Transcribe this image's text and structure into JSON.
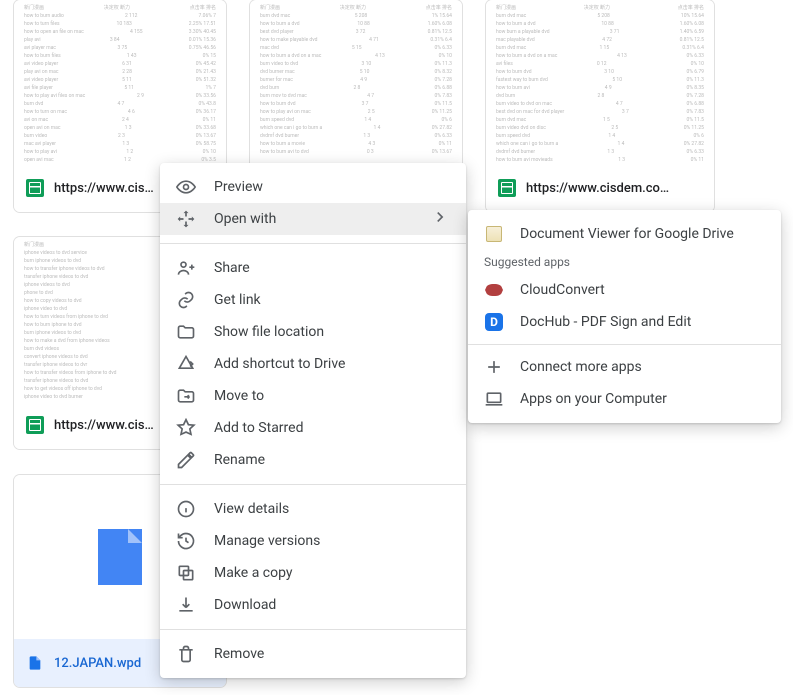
{
  "tiles": {
    "a": {
      "label": "https://www.cis…"
    },
    "b": {
      "label": "https://www.cisdem.co…"
    },
    "c": {
      "label": "https://www.cis…"
    },
    "wpd": {
      "label": "12.JAPAN.wpd"
    }
  },
  "context_menu": {
    "preview": "Preview",
    "open_with": "Open with",
    "share": "Share",
    "get_link": "Get link",
    "show_location": "Show file location",
    "add_shortcut": "Add shortcut to Drive",
    "move_to": "Move to",
    "add_starred": "Add to Starred",
    "rename": "Rename",
    "view_details": "View details",
    "manage_versions": "Manage versions",
    "make_copy": "Make a copy",
    "download": "Download",
    "remove": "Remove"
  },
  "submenu": {
    "doc_viewer": "Document Viewer for Google Drive",
    "suggested": "Suggested apps",
    "cloudconvert": "CloudConvert",
    "dochub": "DocHub - PDF Sign and Edit",
    "connect_more": "Connect more apps",
    "apps_computer": "Apps on your Computer"
  }
}
